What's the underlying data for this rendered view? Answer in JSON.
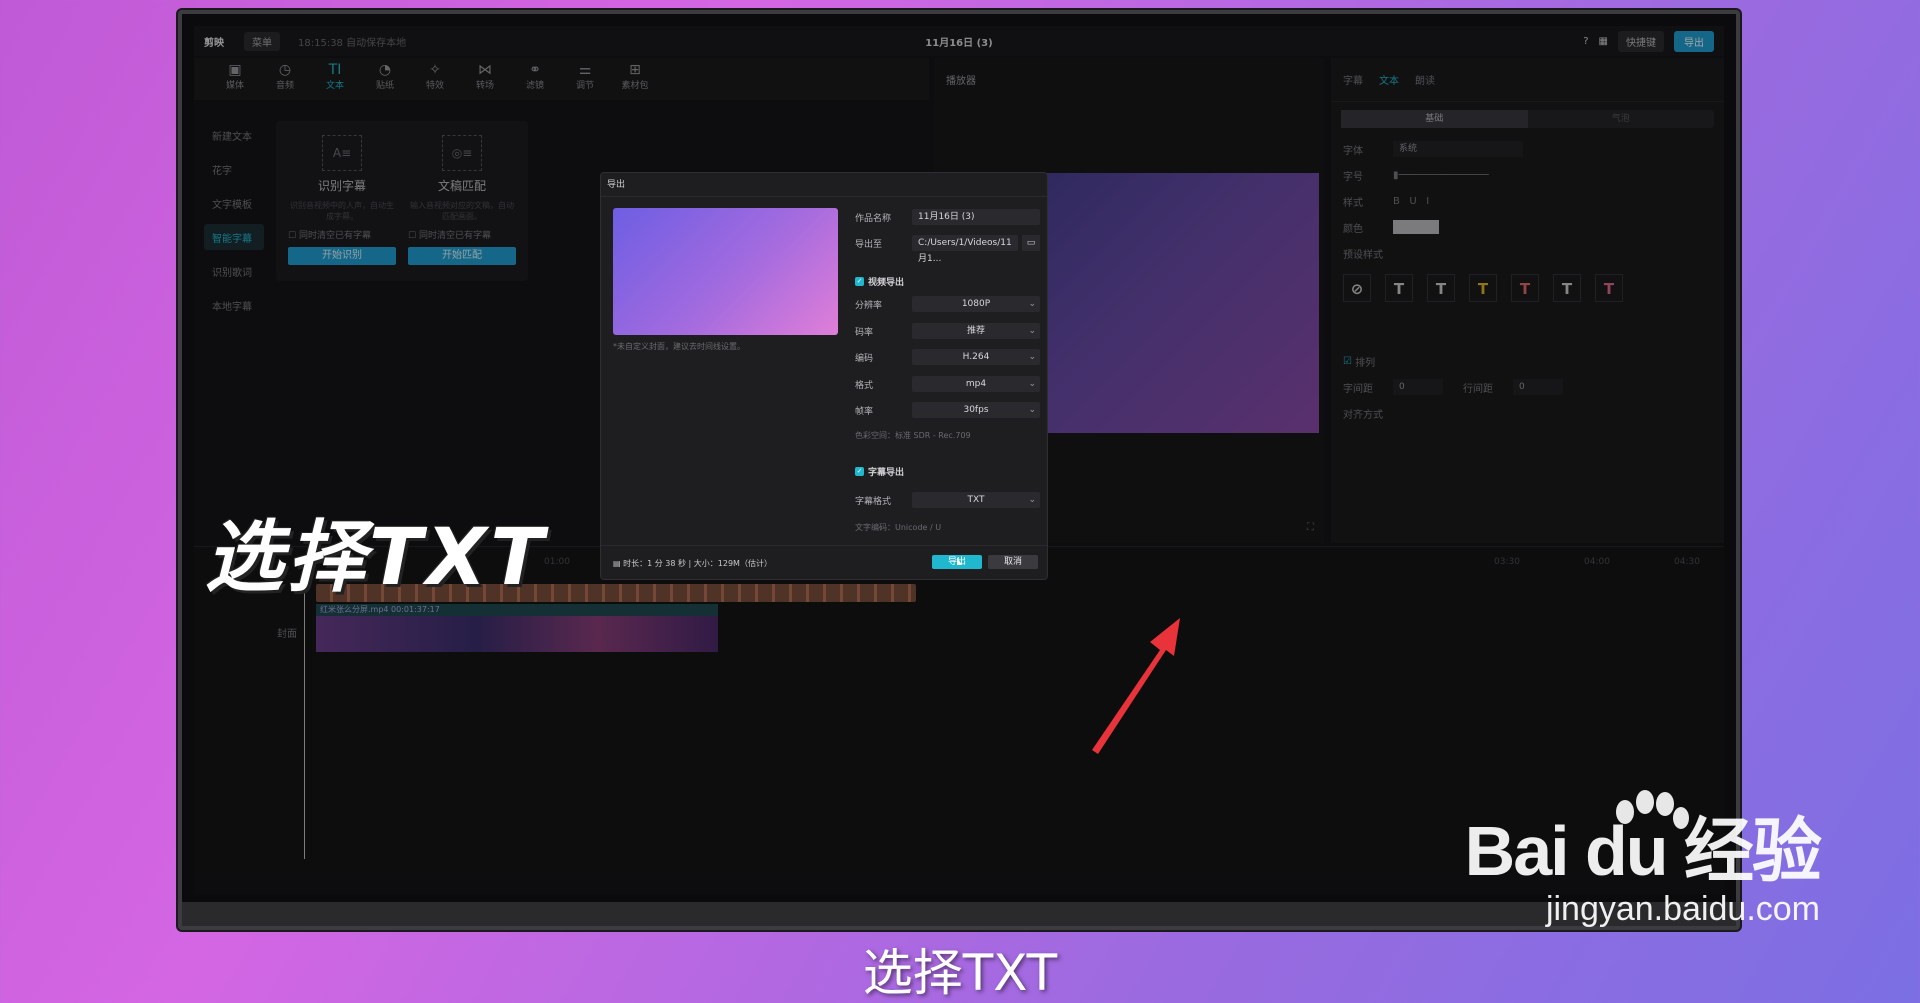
{
  "app": {
    "logo": "剪映",
    "menu": "菜单",
    "saved": "18:15:38 自动保存本地",
    "title": "11月16日 (3)",
    "shortcut": "快捷键",
    "export": "导出"
  },
  "toolbar": [
    "媒体",
    "音频",
    "文本",
    "贴纸",
    "特效",
    "转场",
    "滤镜",
    "调节",
    "素材包"
  ],
  "sidebar": [
    "新建文本",
    "花字",
    "文字模板",
    "智能字幕",
    "识别歌词",
    "本地字幕"
  ],
  "cards": [
    {
      "title": "识别字幕",
      "desc": "识别音视频中的人声，自动生成字幕。",
      "check": "同时清空已有字幕",
      "button": "开始识别"
    },
    {
      "title": "文稿匹配",
      "desc": "输入音视频对应的文稿，自动匹配画面。",
      "check": "同时清空已有字幕",
      "button": "开始匹配"
    }
  ],
  "player": {
    "title": "播放器"
  },
  "right_panel": {
    "tabs": [
      "字幕",
      "文本",
      "朗读"
    ],
    "segments": [
      "基础",
      "气泡"
    ],
    "font_label": "字体",
    "font_value": "系统",
    "size_label": "字号",
    "style_label": "样式",
    "color_label": "颜色",
    "preset_label": "预设样式",
    "arrange_label": "排列",
    "spacing_label": "字间距",
    "spacing_value": "0",
    "line_label": "行间距",
    "line_value": "0",
    "align_label": "对齐方式"
  },
  "timeline": {
    "ruler": [
      "01:00",
      "03:30",
      "04:00",
      "04:30"
    ],
    "clip_label": "红米张么分屏.mp4   00:01:37:17",
    "cover": "封面"
  },
  "dialog": {
    "title": "导出",
    "name_label": "作品名称",
    "name_value": "11月16日 (3)",
    "path_label": "导出至",
    "path_value": "C:/Users/1/Videos/11月1...",
    "note": "*未自定义封面，建议去时间线设置。",
    "video_export": "视频导出",
    "resolution_label": "分辨率",
    "resolution_value": "1080P",
    "bitrate_label": "码率",
    "bitrate_value": "推荐",
    "codec_label": "编码",
    "codec_value": "H.264",
    "format_label": "格式",
    "format_value": "mp4",
    "fps_label": "帧率",
    "fps_value": "30fps",
    "colorspace": "色彩空间：标准 SDR - Rec.709",
    "subtitle_export": "字幕导出",
    "sub_format_label": "字幕格式",
    "sub_format_value": "TXT",
    "encoding": "文字编码：Unicode / U",
    "footer_info": "时长：1 分 38 秒 | 大小：129M（估计）",
    "ok": "导出",
    "cancel": "取消"
  },
  "captions": {
    "big": "选择TXT",
    "sub": "选择TXT"
  },
  "watermark": {
    "brand": "Bai du 经验",
    "url": "jingyan.baidu.com"
  },
  "colors": {
    "accent": "#1fb8cf",
    "arrow": "#e8333a"
  }
}
